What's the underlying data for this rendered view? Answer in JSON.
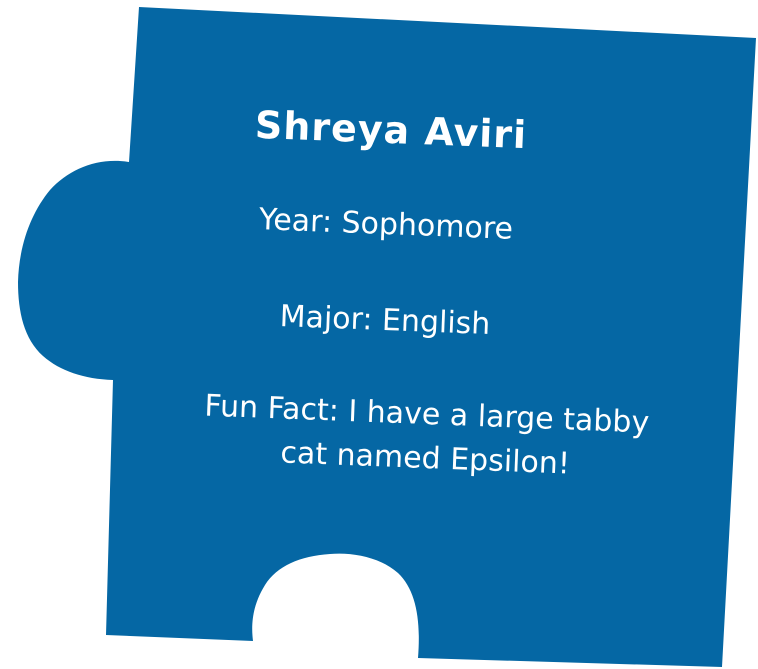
{
  "card": {
    "background_color": "#0567a4",
    "text_color": "#ffffff",
    "name": "Shreya Aviri",
    "year": "Year: Sophomore",
    "major": "Major: English",
    "fun_fact_line_1": "Fun Fact: I have a large tabby",
    "fun_fact_line_2": "cat named Epsilon!"
  }
}
